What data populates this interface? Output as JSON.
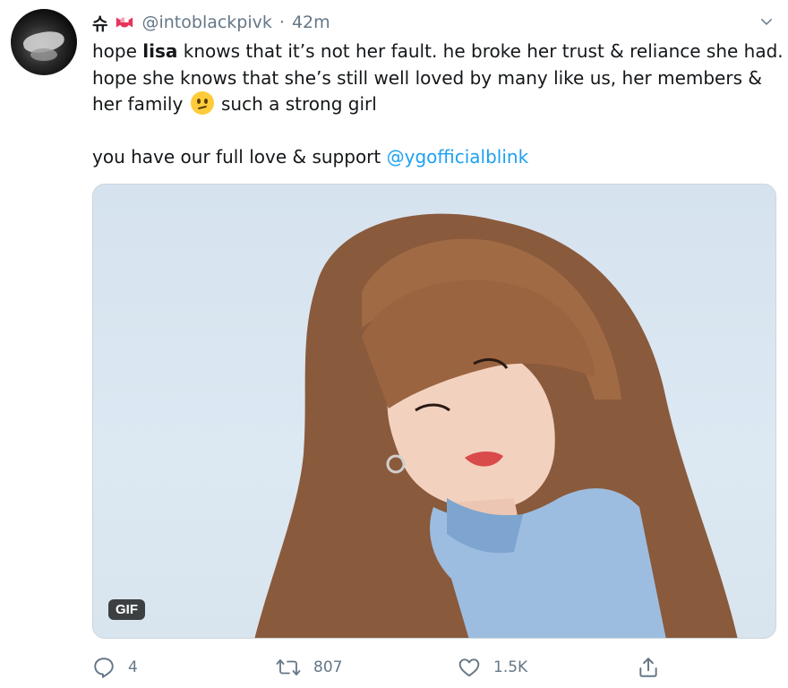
{
  "tweet": {
    "display_name": "슈",
    "handle": "@intoblackpivk",
    "separator": "·",
    "time": "42m",
    "text": {
      "line1_pre": "hope ",
      "line1_bold": "lisa",
      "line1_post": " knows that it’s not her fault. he broke her trust & reliance she had.",
      "line2": "hope she knows that she’s still well loved by many like us, her members &",
      "line3_pre": "her family ",
      "line3_post": " such a strong girl",
      "line4_pre": "you have our full love & support ",
      "mention": "@ygofficialblink"
    },
    "media": {
      "badge": "GIF"
    },
    "actions": {
      "reply_count": "4",
      "retweet_count": "807",
      "like_count": "1.5K"
    }
  },
  "colors": {
    "link": "#1da1f2",
    "secondary_text": "#657786",
    "name_emoji": "#e8345a"
  },
  "icons": {
    "name_emoji": "candy-emoji",
    "caret": "chevron-down-icon",
    "reply": "reply-icon",
    "retweet": "retweet-icon",
    "like": "heart-icon",
    "share": "share-icon"
  }
}
